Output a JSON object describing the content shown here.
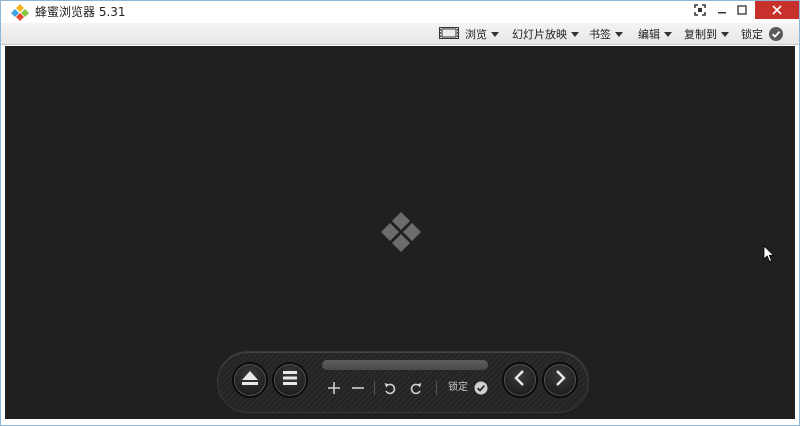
{
  "window": {
    "title": "蜂蜜浏览器 5.31"
  },
  "menubar": {
    "items": [
      {
        "label": "浏览"
      },
      {
        "label": "幻灯片放映"
      },
      {
        "label": "书签"
      },
      {
        "label": "编辑"
      },
      {
        "label": "复制到"
      },
      {
        "label": "锁定"
      }
    ]
  },
  "toolbar": {
    "lock_label": "锁定"
  },
  "icons": {
    "app_logo": "honeyview-logo-icon",
    "fullscreen": "fullscreen-icon",
    "minimize": "minimize-icon",
    "maximize": "maximize-icon",
    "close": "close-icon",
    "filmstrip": "filmstrip-icon",
    "check": "check-circle-icon",
    "eject": "eject-icon",
    "menu": "menu-lines-icon",
    "zoom_in": "plus-icon",
    "zoom_out": "minus-icon",
    "rotate_left": "rotate-left-icon",
    "rotate_right": "rotate-right-icon",
    "previous": "chevron-left-icon",
    "next": "chevron-right-icon",
    "center_logo": "honeyview-placeholder-icon",
    "cursor": "mouse-cursor-icon"
  },
  "colors": {
    "viewer_bg": "#202020",
    "close_button": "#c7302b",
    "menubar_bg": "#ececec"
  }
}
